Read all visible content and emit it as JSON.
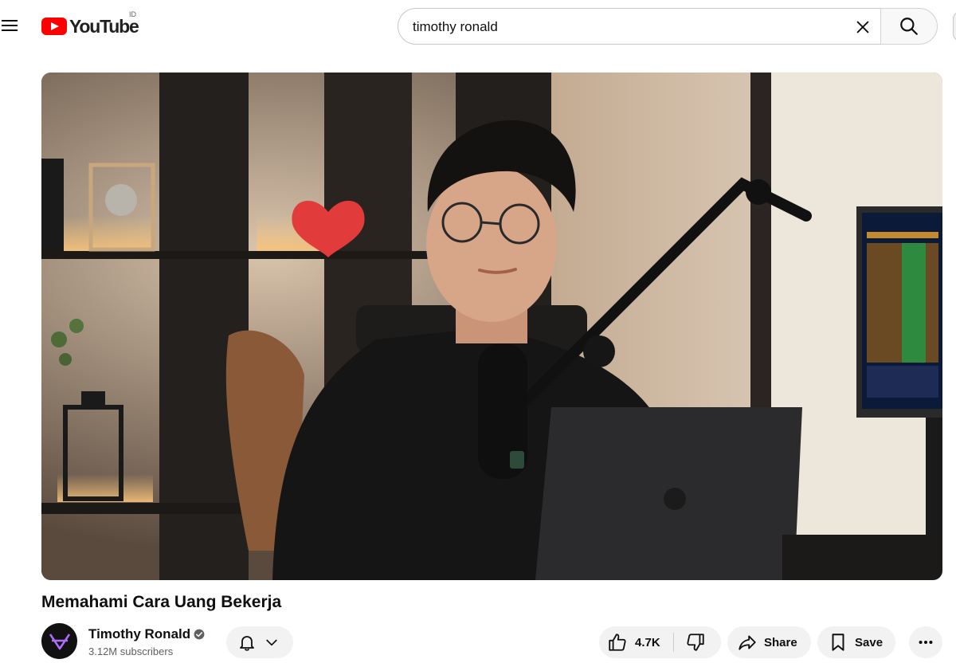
{
  "masthead": {
    "logo_text": "YouTube",
    "country_code": "ID",
    "search_query": "timothy ronald"
  },
  "video": {
    "title": "Memahami Cara Uang Bekerja"
  },
  "channel": {
    "name": "Timothy Ronald",
    "subscribers": "3.12M subscribers",
    "verified": true
  },
  "actions": {
    "like_count": "4.7K",
    "share_label": "Share",
    "save_label": "Save"
  },
  "colors": {
    "brand_red": "#ff0000",
    "pill_bg": "#f2f2f2",
    "avatar_accent": "#b06cff"
  },
  "icons": [
    "menu-icon",
    "youtube-logo-icon",
    "clear-icon",
    "search-icon",
    "verified-icon",
    "bell-icon",
    "chevron-down-icon",
    "thumb-up-icon",
    "thumb-down-icon",
    "share-icon",
    "save-icon",
    "more-icon"
  ]
}
